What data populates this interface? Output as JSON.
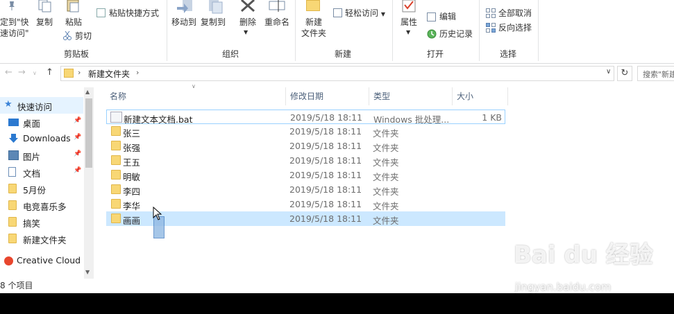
{
  "ribbon": {
    "pin_label_1": "定到\"快",
    "pin_label_2": "速访问\"",
    "copy": "复制",
    "paste": "粘贴",
    "paste_shortcut": "粘贴快捷方式",
    "cut": "剪切",
    "clipboard_group": "剪贴板",
    "move_to": "移动到",
    "copy_to": "复制到",
    "delete": "删除",
    "rename": "重命名",
    "organize_group": "组织",
    "new_folder_1": "新建",
    "new_folder_2": "文件夹",
    "easy_access": "轻松访问",
    "new_group": "新建",
    "properties": "属性",
    "edit": "编辑",
    "history": "历史记录",
    "open_group": "打开",
    "select_none": "全部取消",
    "invert_selection": "反向选择",
    "select_group": "选择"
  },
  "address": {
    "path": "新建文件夹",
    "search_placeholder": "搜索\"新建"
  },
  "nav": {
    "quick_access": "快速访问",
    "items": [
      {
        "label": "桌面",
        "icon": "desktop-icon",
        "pinned": true
      },
      {
        "label": "Downloads",
        "icon": "download-icon",
        "pinned": true
      },
      {
        "label": "图片",
        "icon": "pictures-icon",
        "pinned": true
      },
      {
        "label": "文档",
        "icon": "documents-icon",
        "pinned": true
      },
      {
        "label": "5月份",
        "icon": "folder-icon",
        "pinned": false
      },
      {
        "label": "电竞喜乐多",
        "icon": "folder-icon",
        "pinned": false
      },
      {
        "label": "搞笑",
        "icon": "folder-icon",
        "pinned": false
      },
      {
        "label": "新建文件夹",
        "icon": "folder-icon",
        "pinned": false
      }
    ],
    "creative_cloud": "Creative Cloud F"
  },
  "columns": {
    "name": "名称",
    "date": "修改日期",
    "type": "类型",
    "size": "大小"
  },
  "files": [
    {
      "name": "新建文本文档.bat",
      "date": "2019/5/18 18:11",
      "type": "Windows 批处理...",
      "size": "1 KB",
      "kind": "bat"
    },
    {
      "name": "张三",
      "date": "2019/5/18 18:11",
      "type": "文件夹",
      "size": "",
      "kind": "folder"
    },
    {
      "name": "张强",
      "date": "2019/5/18 18:11",
      "type": "文件夹",
      "size": "",
      "kind": "folder"
    },
    {
      "name": "王五",
      "date": "2019/5/18 18:11",
      "type": "文件夹",
      "size": "",
      "kind": "folder"
    },
    {
      "name": "明敏",
      "date": "2019/5/18 18:11",
      "type": "文件夹",
      "size": "",
      "kind": "folder"
    },
    {
      "name": "李四",
      "date": "2019/5/18 18:11",
      "type": "文件夹",
      "size": "",
      "kind": "folder"
    },
    {
      "name": "李华",
      "date": "2019/5/18 18:11",
      "type": "文件夹",
      "size": "",
      "kind": "folder"
    },
    {
      "name": "画画",
      "date": "2019/5/18 18:11",
      "type": "文件夹",
      "size": "",
      "kind": "folder"
    }
  ],
  "status": {
    "count": "8 个项目"
  },
  "watermark": {
    "main": "Bai du 经验",
    "sub": "jingyan.baidu.com"
  },
  "colors": {
    "selection": "#cce8ff",
    "focus_border": "#99d1ff",
    "folder": "#f8d775",
    "header_text": "#4c607a"
  }
}
